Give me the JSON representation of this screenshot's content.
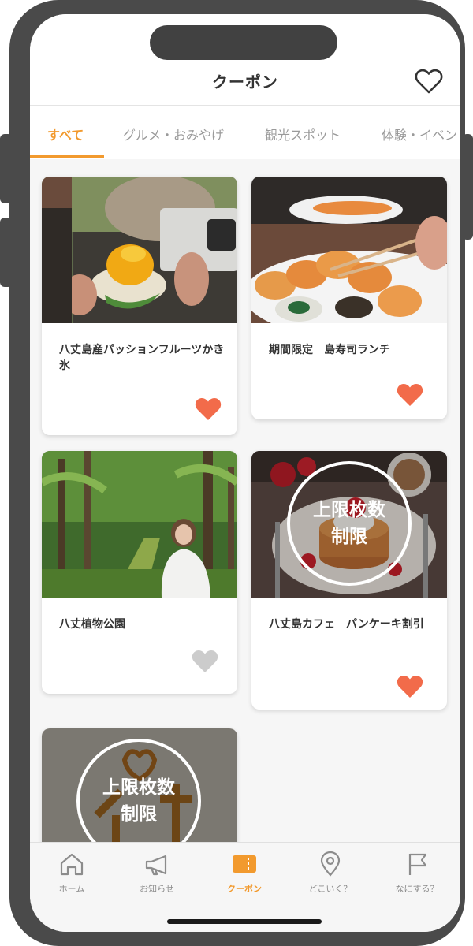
{
  "header": {
    "title": "クーポン",
    "favorite_icon": "heart-outline-icon"
  },
  "tabs": [
    {
      "label": "すべて",
      "active": true
    },
    {
      "label": "グルメ・おみやげ",
      "active": false
    },
    {
      "label": "観光スポット",
      "active": false
    },
    {
      "label": "体験・イベン",
      "active": false
    }
  ],
  "coupons": [
    {
      "title": "八丈島産パッションフルーツかき氷",
      "favorited": true,
      "limit_badge": null
    },
    {
      "title": "期間限定　島寿司ランチ",
      "favorited": true,
      "limit_badge": null
    },
    {
      "title": "八丈植物公園",
      "favorited": false,
      "limit_badge": null
    },
    {
      "title": "八丈島カフェ　パンケーキ割引",
      "favorited": true,
      "limit_badge": {
        "line1": "上限枚数",
        "line2": "制限"
      }
    },
    {
      "title": "",
      "favorited": false,
      "limit_badge": {
        "line1": "上限枚数",
        "line2": "制限"
      }
    }
  ],
  "bottom_nav": [
    {
      "label": "ホーム",
      "icon": "home-icon",
      "active": false
    },
    {
      "label": "お知らせ",
      "icon": "megaphone-icon",
      "active": false
    },
    {
      "label": "クーポン",
      "icon": "ticket-icon",
      "active": true
    },
    {
      "label": "どこいく？",
      "icon": "map-pin-icon",
      "active": false
    },
    {
      "label": "なにする？",
      "icon": "flag-icon",
      "active": false
    }
  ],
  "colors": {
    "accent": "#f29a2e",
    "heart_active": "#f26b4a",
    "heart_inactive": "#cccccc"
  }
}
